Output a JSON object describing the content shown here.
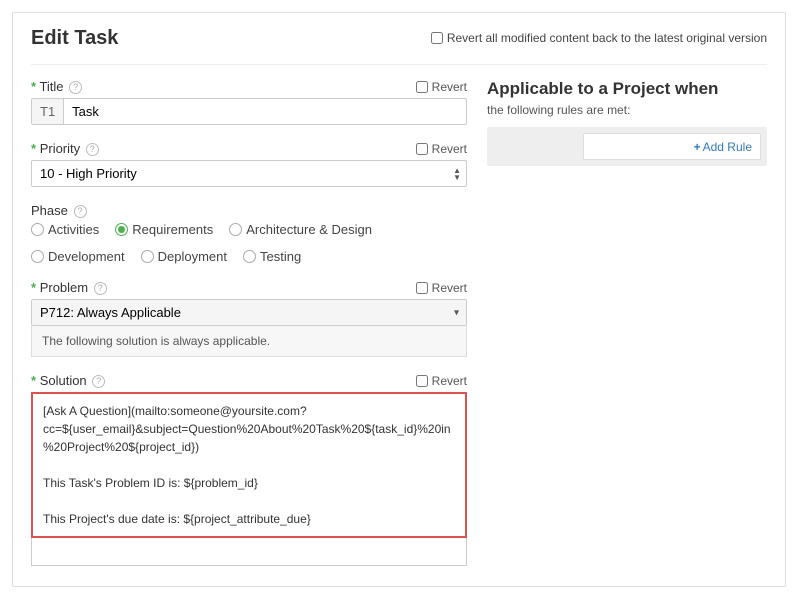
{
  "page": {
    "title": "Edit Task",
    "revert_all_label": "Revert all modified content back to the latest original version"
  },
  "fields": {
    "title": {
      "label": "Title",
      "required": true,
      "prefix": "T1",
      "value": "Task",
      "revert_label": "Revert"
    },
    "priority": {
      "label": "Priority",
      "required": true,
      "value": "10 - High Priority",
      "revert_label": "Revert"
    },
    "phase": {
      "label": "Phase",
      "options": [
        "Activities",
        "Requirements",
        "Architecture & Design",
        "Development",
        "Deployment",
        "Testing"
      ],
      "selected_index": 1
    },
    "problem": {
      "label": "Problem",
      "required": true,
      "value": "P712: Always Applicable",
      "note": "The following solution is always applicable.",
      "revert_label": "Revert"
    },
    "solution": {
      "label": "Solution",
      "required": true,
      "revert_label": "Revert",
      "value": "[Ask A Question](mailto:someone@yoursite.com?cc=${user_email}&subject=Question%20About%20Task%20${task_id}%20in%20Project%20${project_id})\n\nThis Task's Problem ID is: ${problem_id}\n\nThis Project's due date is: ${project_attribute_due}"
    }
  },
  "right": {
    "heading": "Applicable to a Project when",
    "subtext": "the following rules are met:",
    "add_rule_label": "Add Rule"
  }
}
